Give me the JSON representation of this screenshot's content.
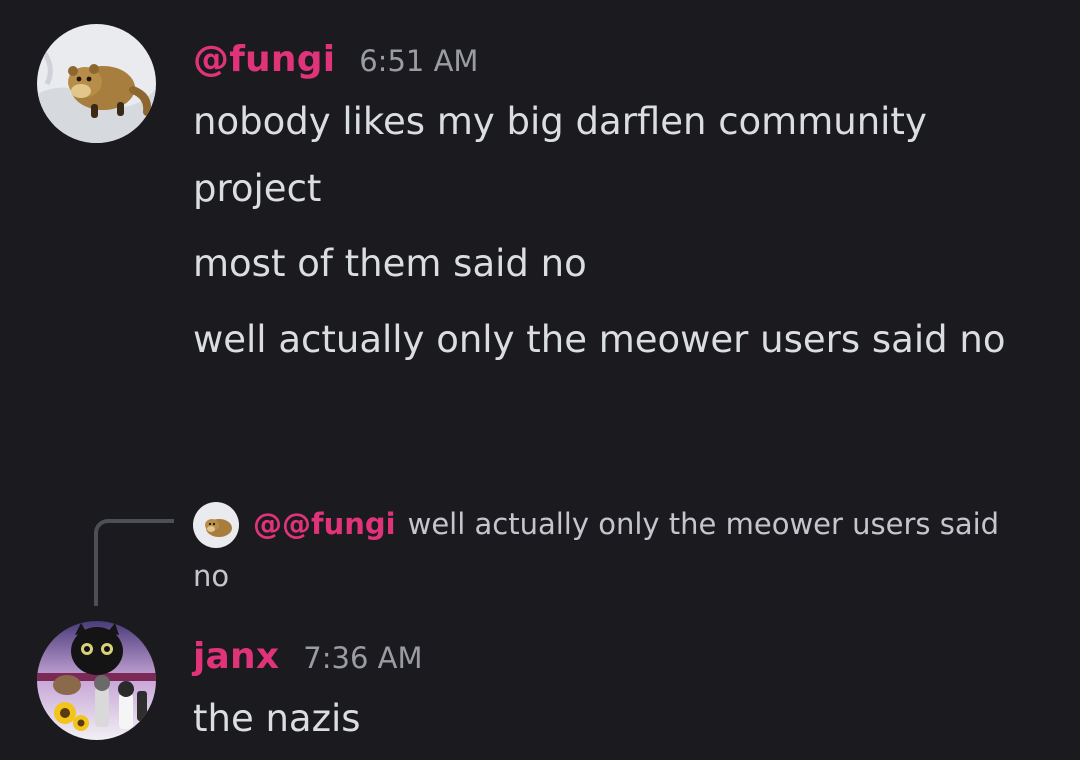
{
  "messages": [
    {
      "username": "@fungi",
      "time": "6:51 AM",
      "avatar": "marten-in-snow-avatar",
      "lines": [
        "nobody likes my big darflen community project",
        "most of them said no",
        "well actually only the meower users said no"
      ]
    },
    {
      "reply": {
        "mention": "@@fungi",
        "text": "well actually only the meower users said no",
        "avatar": "marten-in-snow-avatar"
      },
      "username": "janx",
      "time": "7:36 AM",
      "avatar": "cat-collage-avatar",
      "lines": [
        "the nazis"
      ]
    }
  ],
  "colors": {
    "background": "#1b1b1f",
    "username": "#e0337a",
    "text": "#dbdee1",
    "timestamp": "#9a9ca3",
    "reply_line": "#4d4f57"
  }
}
